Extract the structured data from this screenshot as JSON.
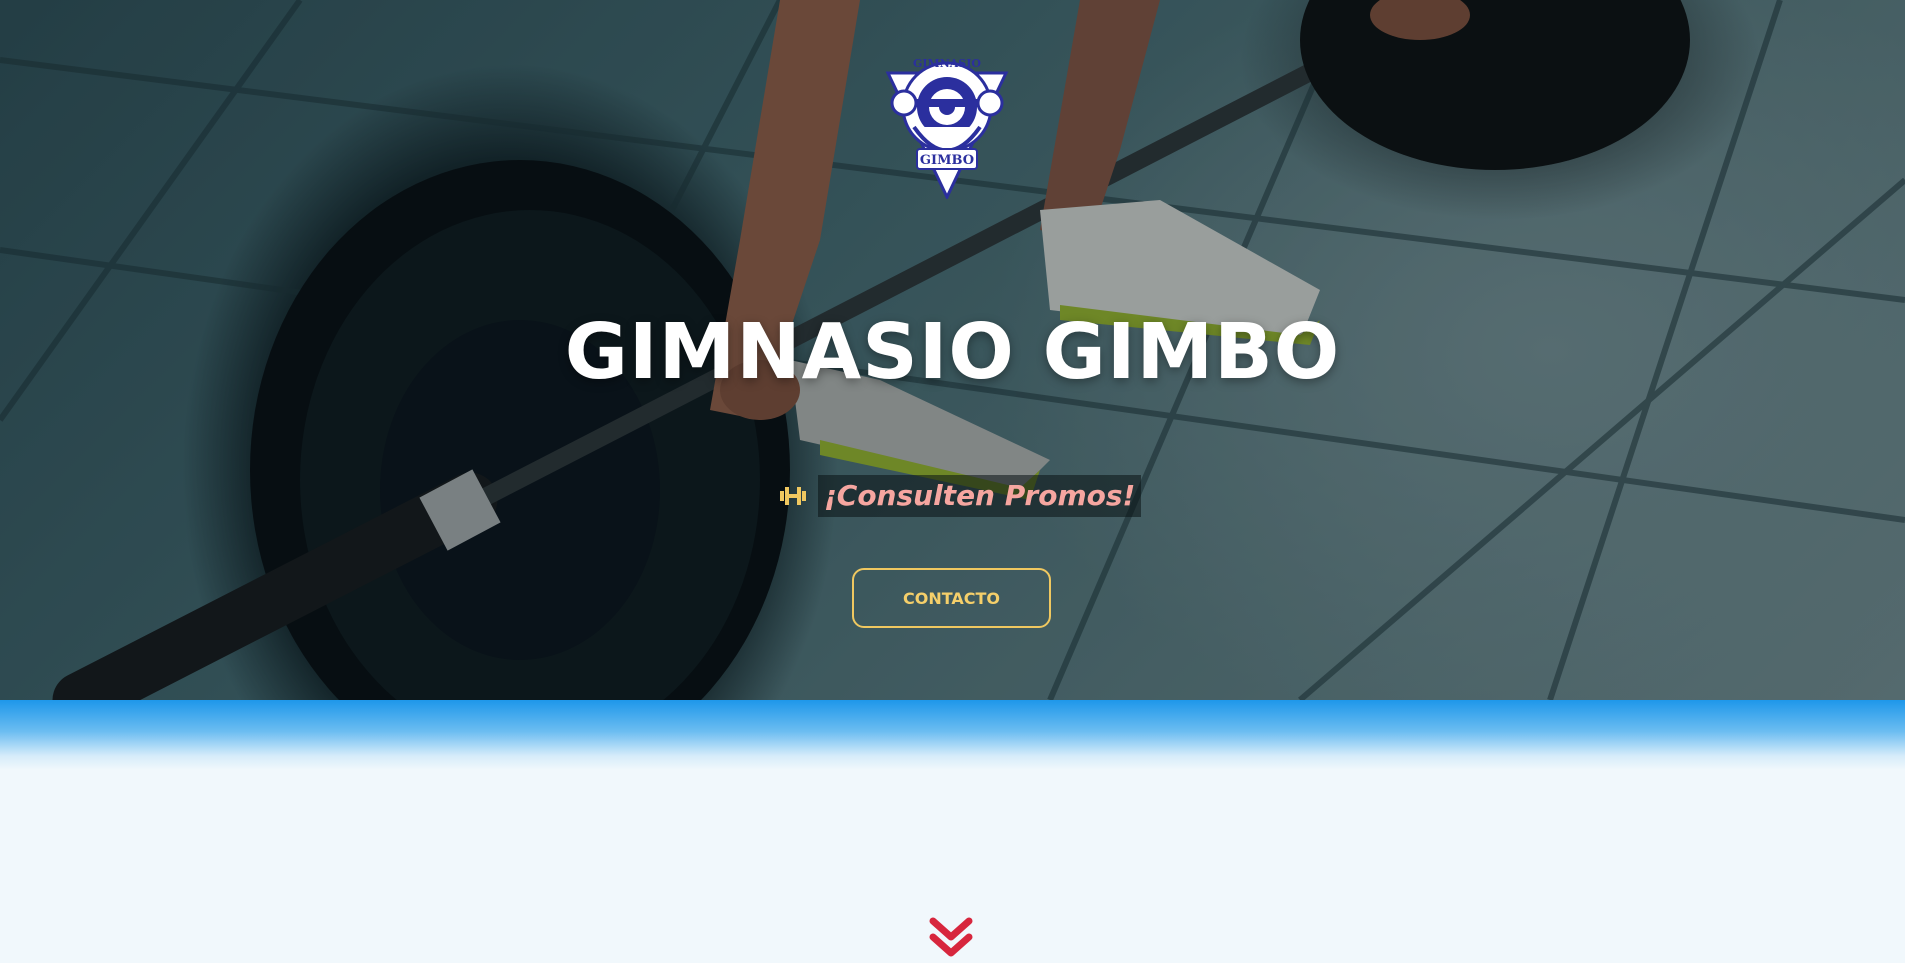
{
  "hero": {
    "logo_text_top": "GIMNASIO",
    "logo_text_bottom": "GIMBO",
    "title": "GIMNASIO GIMBO",
    "promo_text": "¡Consulten Promos!",
    "promo_icon": "dumbbell-icon",
    "cta_label": "CONTACTO"
  },
  "scroll_icon": "chevron-double-down-icon",
  "colors": {
    "accent_gold": "#f0c860",
    "promo_pink": "#f6a6a0",
    "band_blue": "#1e97ea",
    "chevron_red": "#d7263d",
    "logo_blue": "#2b2f9e"
  }
}
